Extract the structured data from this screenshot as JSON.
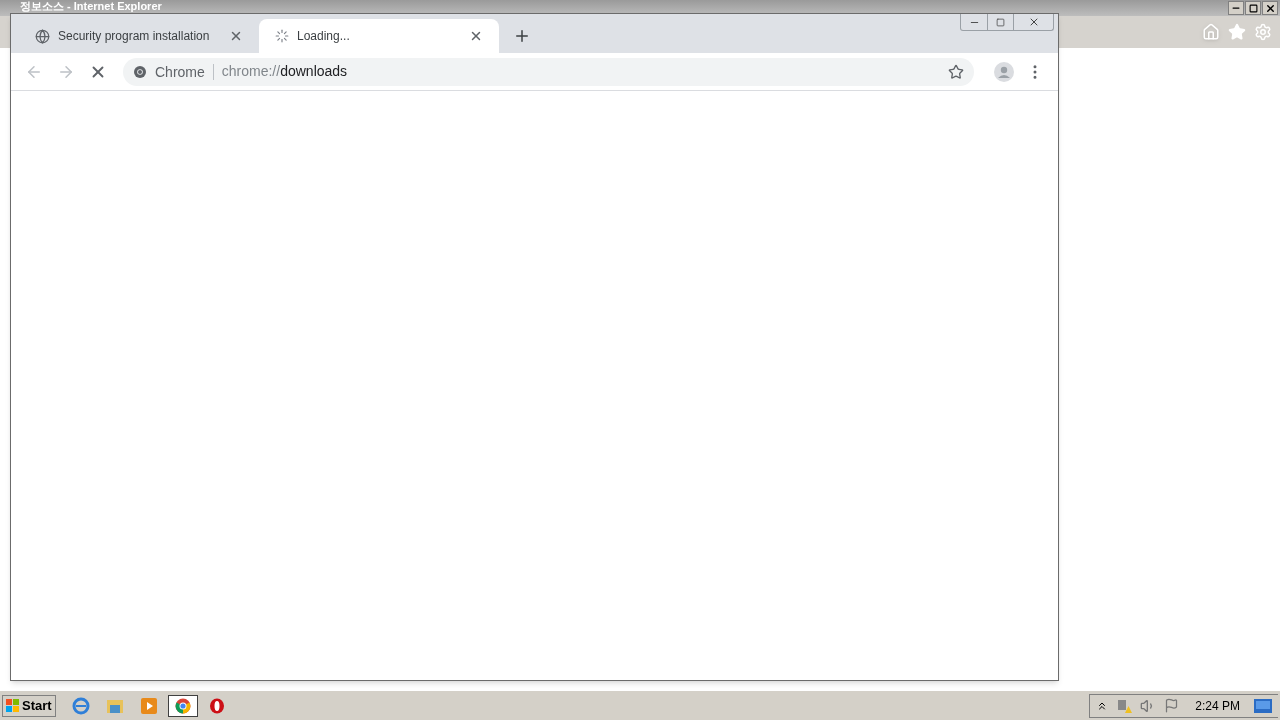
{
  "ie_window": {
    "title": "정보소스 - Internet Explorer"
  },
  "chrome": {
    "tabs": [
      {
        "title": "Security program installation",
        "selected": false,
        "loading": false
      },
      {
        "title": "Loading...",
        "selected": true,
        "loading": true
      }
    ],
    "omnibox": {
      "chip": "Chrome",
      "url_scheme": "chrome://",
      "url_path": "downloads"
    }
  },
  "taskbar": {
    "start": "Start",
    "apps": [
      {
        "kind": "ie",
        "selected": false
      },
      {
        "kind": "explorer",
        "selected": false
      },
      {
        "kind": "media",
        "selected": false
      },
      {
        "kind": "chrome",
        "selected": true
      },
      {
        "kind": "opera",
        "selected": false
      }
    ],
    "clock": "2:24 PM"
  }
}
